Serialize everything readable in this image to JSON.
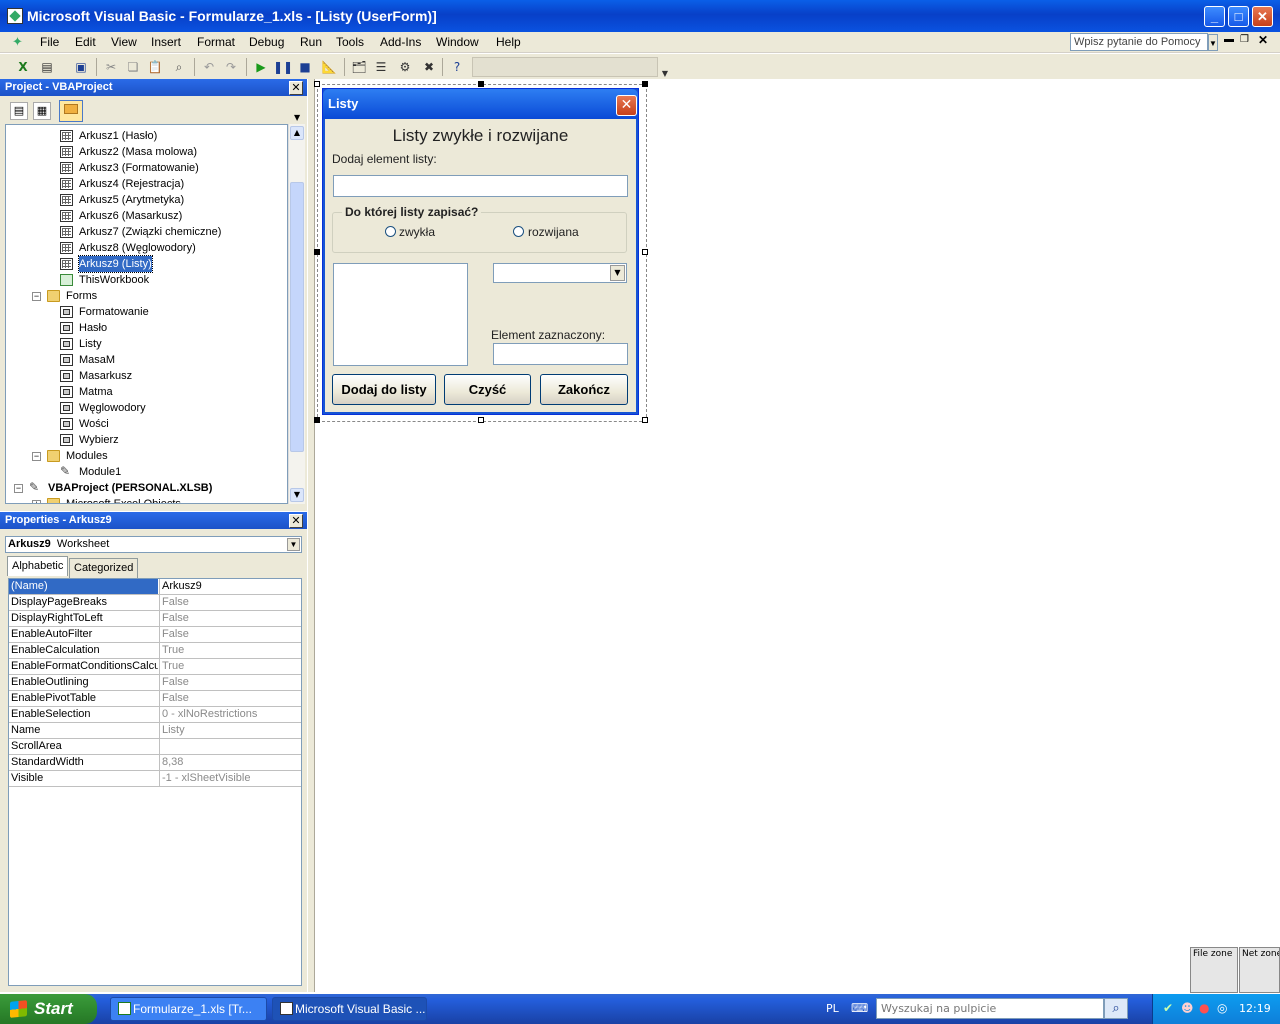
{
  "window": {
    "title": "Microsoft Visual Basic - Formularze_1.xls - [Listy (UserForm)]",
    "min_label": "_",
    "max_label": "□",
    "close_label": "✕"
  },
  "menu": {
    "items": [
      "File",
      "Edit",
      "View",
      "Insert",
      "Format",
      "Debug",
      "Run",
      "Tools",
      "Add-Ins",
      "Window",
      "Help"
    ],
    "help_placeholder": "Wpisz pytanie do Pomocy"
  },
  "project": {
    "title": "Project - VBAProject",
    "tree": [
      {
        "label": "Arkusz1 (Hasło)",
        "icon": "sheet",
        "depth": 2
      },
      {
        "label": "Arkusz2 (Masa molowa)",
        "icon": "sheet",
        "depth": 2
      },
      {
        "label": "Arkusz3 (Formatowanie)",
        "icon": "sheet",
        "depth": 2
      },
      {
        "label": "Arkusz4 (Rejestracja)",
        "icon": "sheet",
        "depth": 2
      },
      {
        "label": "Arkusz5 (Arytmetyka)",
        "icon": "sheet",
        "depth": 2
      },
      {
        "label": "Arkusz6 (Masarkusz)",
        "icon": "sheet",
        "depth": 2
      },
      {
        "label": "Arkusz7 (Związki chemiczne)",
        "icon": "sheet",
        "depth": 2
      },
      {
        "label": "Arkusz8 (Węglowodory)",
        "icon": "sheet",
        "depth": 2
      },
      {
        "label": "Arkusz9 (Listy)",
        "icon": "sheet",
        "depth": 2,
        "selected": true
      },
      {
        "label": "ThisWorkbook",
        "icon": "book",
        "depth": 2
      },
      {
        "label": "Forms",
        "icon": "folder",
        "depth": 1,
        "expander": "−"
      },
      {
        "label": "Formatowanie",
        "icon": "form",
        "depth": 2
      },
      {
        "label": "Hasło",
        "icon": "form",
        "depth": 2
      },
      {
        "label": "Listy",
        "icon": "form",
        "depth": 2
      },
      {
        "label": "MasaM",
        "icon": "form",
        "depth": 2
      },
      {
        "label": "Masarkusz",
        "icon": "form",
        "depth": 2
      },
      {
        "label": "Matma",
        "icon": "form",
        "depth": 2
      },
      {
        "label": "Węglowodory",
        "icon": "form",
        "depth": 2
      },
      {
        "label": "Wości",
        "icon": "form",
        "depth": 2
      },
      {
        "label": "Wybierz",
        "icon": "form",
        "depth": 2
      },
      {
        "label": "Modules",
        "icon": "folder",
        "depth": 1,
        "expander": "−"
      },
      {
        "label": "Module1",
        "icon": "module",
        "depth": 2
      },
      {
        "label": "VBAProject (PERSONAL.XLSB)",
        "icon": "project",
        "depth": 0,
        "expander": "−",
        "bold": true
      },
      {
        "label": "Microsoft Excel Objects",
        "icon": "folder",
        "depth": 1,
        "expander": "+"
      }
    ]
  },
  "properties": {
    "title": "Properties - Arkusz9",
    "object_name": "Arkusz9",
    "object_type": "Worksheet",
    "tabs": [
      "Alphabetic",
      "Categorized"
    ],
    "rows": [
      {
        "name": "(Name)",
        "value": "Arkusz9"
      },
      {
        "name": "DisplayPageBreaks",
        "value": "False"
      },
      {
        "name": "DisplayRightToLeft",
        "value": "False"
      },
      {
        "name": "EnableAutoFilter",
        "value": "False"
      },
      {
        "name": "EnableCalculation",
        "value": "True"
      },
      {
        "name": "EnableFormatConditionsCalcula",
        "value": "True"
      },
      {
        "name": "EnableOutlining",
        "value": "False"
      },
      {
        "name": "EnablePivotTable",
        "value": "False"
      },
      {
        "name": "EnableSelection",
        "value": "0 - xlNoRestrictions"
      },
      {
        "name": "Name",
        "value": "Listy"
      },
      {
        "name": "ScrollArea",
        "value": ""
      },
      {
        "name": "StandardWidth",
        "value": "8,38"
      },
      {
        "name": "Visible",
        "value": "-1 - xlSheetVisible"
      }
    ]
  },
  "form": {
    "title": "Listy",
    "heading": "Listy zwykłe i rozwijane",
    "add_label": "Dodaj element listy:",
    "frame_label": "Do której listy zapisać?",
    "radio1": "zwykła",
    "radio2": "rozwijana",
    "selected_label": "Element zaznaczony:",
    "btn_add": "Dodaj do listy",
    "btn_clear": "Czyść",
    "btn_close": "Zakończ"
  },
  "taskbar": {
    "start": "Start",
    "tasks": [
      "Formularze_1.xls  [Tr...",
      "Microsoft Visual Basic ..."
    ],
    "lang": "PL",
    "search_placeholder": "Wyszukaj na pulpicie",
    "clock": "12:19"
  },
  "zones": [
    "File zone",
    "Net zone"
  ],
  "colors": {
    "titlebar": "#0a52e0",
    "selection": "#316ac5",
    "start": "#2f8a2f"
  }
}
